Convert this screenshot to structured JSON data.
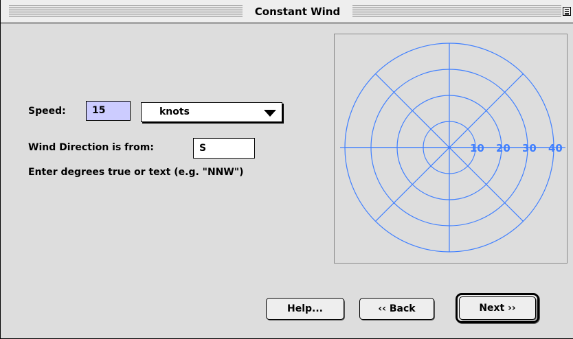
{
  "window": {
    "title": "Constant Wind"
  },
  "speed": {
    "label": "Speed:",
    "value": "15",
    "unit": "knots"
  },
  "direction": {
    "label": "Wind Direction is from:",
    "value": "S",
    "hint": "Enter  degrees true or text (e.g. \"NNW\")"
  },
  "plot": {
    "ring_labels": [
      "10",
      "20",
      "30",
      "40"
    ],
    "color": "#3f7fff"
  },
  "buttons": {
    "help": "Help...",
    "back": "‹‹ Back",
    "next": "Next ››"
  }
}
